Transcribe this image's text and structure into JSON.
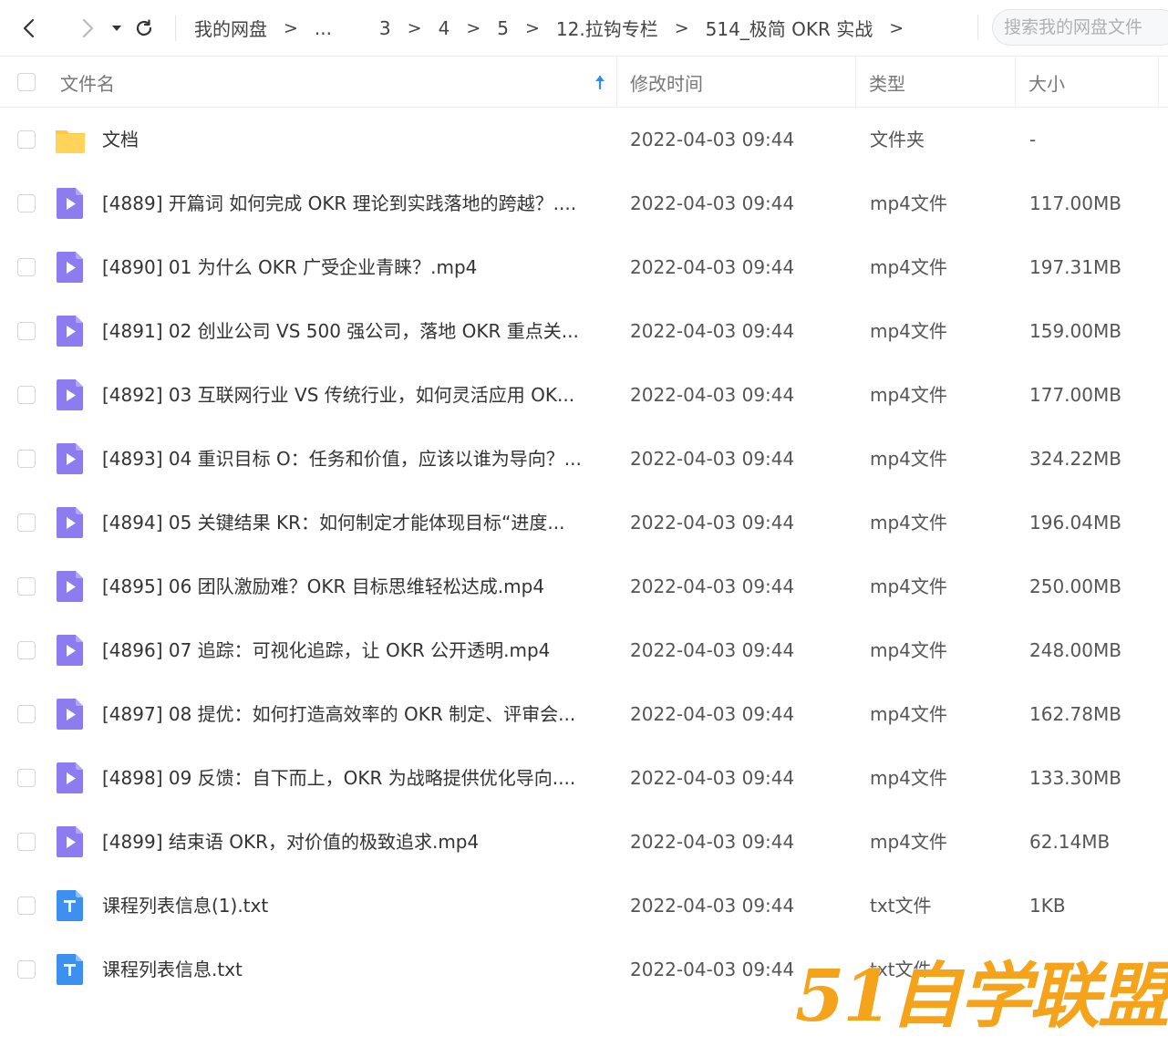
{
  "toolbar": {
    "back_icon": "chevron-left-icon",
    "forward_icon": "chevron-right-icon",
    "history_icon": "caret-down-icon",
    "refresh_icon": "refresh-icon",
    "breadcrumbs": [
      "我的网盘",
      "...",
      "3",
      "4",
      "5",
      "12.拉钩专栏",
      "514_极简 OKR 实战"
    ],
    "separator": ">",
    "search_placeholder": "搜索我的网盘文件"
  },
  "table": {
    "columns": {
      "name": "文件名",
      "modified": "修改时间",
      "type": "类型",
      "size": "大小"
    },
    "sort_icon": "arrow-up-icon",
    "rows": [
      {
        "icon": "folder-icon",
        "name": "文档",
        "modified": "2022-04-03 09:44",
        "type": "文件夹",
        "size": "-"
      },
      {
        "icon": "video-file-icon",
        "name": "[4889] 开篇词  如何完成 OKR 理论到实践落地的跨越？....",
        "modified": "2022-04-03 09:44",
        "type": "mp4文件",
        "size": "117.00MB"
      },
      {
        "icon": "video-file-icon",
        "name": "[4890] 01  为什么 OKR 广受企业青睐？.mp4",
        "modified": "2022-04-03 09:44",
        "type": "mp4文件",
        "size": "197.31MB"
      },
      {
        "icon": "video-file-icon",
        "name": "[4891] 02  创业公司 VS 500 强公司，落地 OKR 重点关...",
        "modified": "2022-04-03 09:44",
        "type": "mp4文件",
        "size": "159.00MB"
      },
      {
        "icon": "video-file-icon",
        "name": "[4892] 03  互联网行业 VS 传统行业，如何灵活应用 OK...",
        "modified": "2022-04-03 09:44",
        "type": "mp4文件",
        "size": "177.00MB"
      },
      {
        "icon": "video-file-icon",
        "name": "[4893] 04  重识目标 O：任务和价值，应该以谁为导向？...",
        "modified": "2022-04-03 09:44",
        "type": "mp4文件",
        "size": "324.22MB"
      },
      {
        "icon": "video-file-icon",
        "name": "[4894] 05  关键结果 KR：如何制定才能体现目标“进度...",
        "modified": "2022-04-03 09:44",
        "type": "mp4文件",
        "size": "196.04MB"
      },
      {
        "icon": "video-file-icon",
        "name": "[4895] 06  团队激励难？OKR 目标思维轻松达成.mp4",
        "modified": "2022-04-03 09:44",
        "type": "mp4文件",
        "size": "250.00MB"
      },
      {
        "icon": "video-file-icon",
        "name": "[4896] 07  追踪：可视化追踪，让 OKR 公开透明.mp4",
        "modified": "2022-04-03 09:44",
        "type": "mp4文件",
        "size": "248.00MB"
      },
      {
        "icon": "video-file-icon",
        "name": "[4897] 08  提优：如何打造高效率的 OKR 制定、评审会...",
        "modified": "2022-04-03 09:44",
        "type": "mp4文件",
        "size": "162.78MB"
      },
      {
        "icon": "video-file-icon",
        "name": "[4898] 09  反馈：自下而上，OKR 为战略提供优化导向....",
        "modified": "2022-04-03 09:44",
        "type": "mp4文件",
        "size": "133.30MB"
      },
      {
        "icon": "video-file-icon",
        "name": "[4899] 结束语  OKR，对价值的极致追求.mp4",
        "modified": "2022-04-03 09:44",
        "type": "mp4文件",
        "size": "62.14MB"
      },
      {
        "icon": "text-file-icon",
        "name": "课程列表信息(1).txt",
        "modified": "2022-04-03 09:44",
        "type": "txt文件",
        "size": "1KB"
      },
      {
        "icon": "text-file-icon",
        "name": "课程列表信息.txt",
        "modified": "2022-04-03 09:44",
        "type": "txt文件",
        "size": ""
      }
    ]
  },
  "colors": {
    "folder": "#FFC93C",
    "video": "#8C7CF0",
    "text_file": "#3D8FF0",
    "sort_arrow": "#2D8CF0",
    "watermark": "#F5A31A"
  },
  "watermark": {
    "text": "51自学联盟"
  }
}
